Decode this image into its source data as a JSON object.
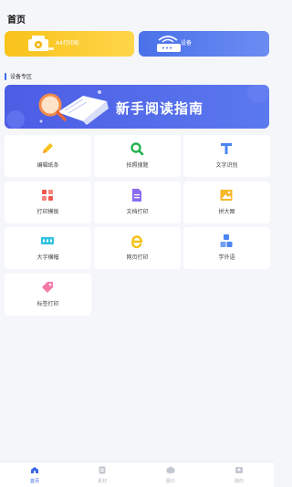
{
  "header": {
    "title": "首页"
  },
  "top_buttons": {
    "print_label": "A4打印纸",
    "device_label": "设备"
  },
  "section": {
    "title": "设备专区"
  },
  "guide_banner": {
    "text": "新手阅读指南"
  },
  "tools": [
    {
      "label": "编辑纸条",
      "icon": "pencil-icon"
    },
    {
      "label": "拍照搜题",
      "icon": "search-icon"
    },
    {
      "label": "文字识别",
      "icon": "text-icon"
    },
    {
      "label": "打印模板",
      "icon": "template-grid-icon"
    },
    {
      "label": "文档打印",
      "icon": "document-icon"
    },
    {
      "label": "拼大图",
      "icon": "image-icon"
    },
    {
      "label": "大字横幅",
      "icon": "banner-icon"
    },
    {
      "label": "网页打印",
      "icon": "web-e-icon"
    },
    {
      "label": "学外语",
      "icon": "abc-icon"
    },
    {
      "label": "标签打印",
      "icon": "tag-icon"
    }
  ],
  "tabbar": [
    {
      "label": "首页",
      "icon": "home-icon",
      "active": true
    },
    {
      "label": "素材",
      "icon": "material-icon",
      "active": false
    },
    {
      "label": "圈子",
      "icon": "circle-icon",
      "active": false
    },
    {
      "label": "我的",
      "icon": "profile-icon",
      "active": false
    }
  ],
  "colors": {
    "accent": "#3b67e8",
    "print_button": "#f8c21a",
    "device_button": "#4a71e8",
    "banner": "#4c5de4"
  }
}
